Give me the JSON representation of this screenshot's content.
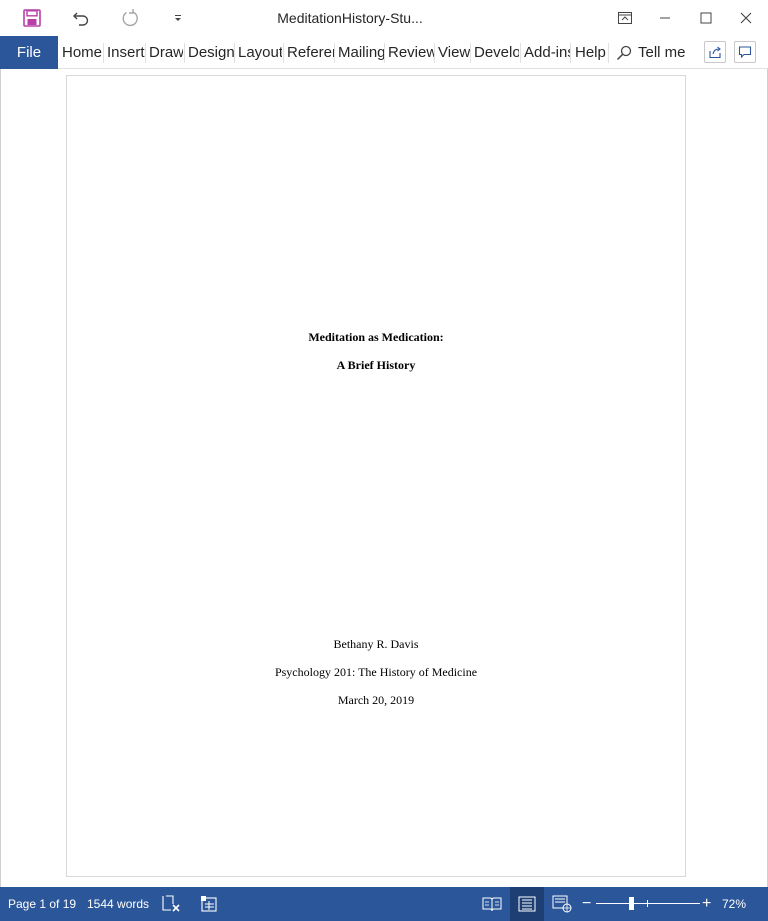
{
  "window": {
    "title": "MeditationHistory-Stu..."
  },
  "ribbon": {
    "file_label": "File",
    "tabs": [
      "Home",
      "Insert",
      "Draw",
      "Design",
      "Layout",
      "Referen",
      "Mailing",
      "Review",
      "View",
      "Develo",
      "Add-ins",
      "Help"
    ],
    "tell_me": "Tell me"
  },
  "document": {
    "title_line1": "Meditation as Medication:",
    "title_line2": "A Brief History",
    "author": "Bethany R. Davis",
    "course": "Psychology 201: The History of Medicine",
    "date": "March 20, 2019"
  },
  "status": {
    "page": "Page 1 of 19",
    "words": "1544 words",
    "zoom": "72%",
    "zoom_minus": "−",
    "zoom_plus": "+"
  },
  "colors": {
    "accent": "#2b579a",
    "save_icon": "#b83fa8"
  },
  "icons": [
    "save-icon",
    "undo-icon",
    "redo-icon",
    "customize-qat-icon",
    "ribbon-display-icon",
    "minimize-icon",
    "maximize-icon",
    "close-icon",
    "search-icon",
    "share-icon",
    "comments-icon",
    "spelling-icon",
    "accessibility-icon",
    "read-mode-icon",
    "print-layout-icon",
    "web-layout-icon"
  ]
}
